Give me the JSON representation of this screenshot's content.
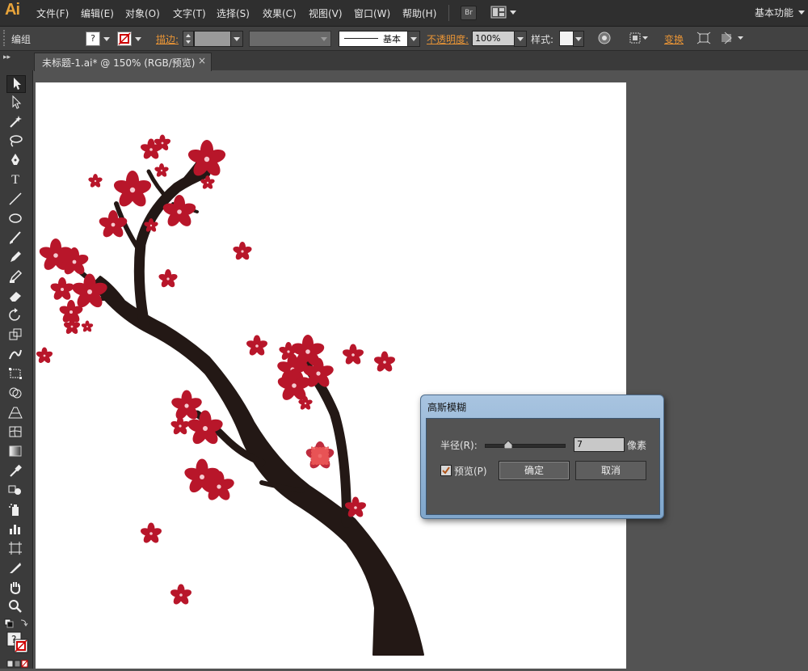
{
  "app": {
    "logo": "Ai"
  },
  "menu": {
    "items": [
      "文件(F)",
      "编辑(E)",
      "对象(O)",
      "文字(T)",
      "选择(S)",
      "效果(C)",
      "视图(V)",
      "窗口(W)",
      "帮助(H)"
    ],
    "bridge_label": "Br",
    "workspace": "基本功能"
  },
  "control": {
    "object_type": "编组",
    "fill_label": "?",
    "stroke_label": "描边:",
    "brush_label": "基本",
    "opacity_label": "不透明度:",
    "opacity_value": "100%",
    "style_label": "样式:",
    "transform_label": "变换"
  },
  "document": {
    "tab_title": "未标题-1.ai* @ 150% (RGB/预览)",
    "close_glyph": "×"
  },
  "dialog": {
    "title": "高斯模糊",
    "radius_label": "半径(R):",
    "radius_value": "7",
    "unit": "像素",
    "slider_level": 0.3,
    "preview_label": "预览(P)",
    "preview_checked": true,
    "ok_label": "确定",
    "cancel_label": "取消"
  },
  "colors": {
    "blossom": "#b8162a",
    "branch": "#231815",
    "accent": "#e89436",
    "selection": "#f05a5a"
  },
  "tools": [
    "selection-tool",
    "direct-selection-tool",
    "magic-wand-tool",
    "lasso-tool",
    "pen-tool",
    "type-tool",
    "line-tool",
    "ellipse-tool",
    "paintbrush-tool",
    "pencil-tool",
    "blob-brush-tool",
    "eraser-tool",
    "rotate-tool",
    "scale-tool",
    "warp-tool",
    "free-transform-tool",
    "shape-builder-tool",
    "perspective-grid-tool",
    "mesh-tool",
    "gradient-tool",
    "eyedropper-tool",
    "blend-tool",
    "symbol-sprayer-tool",
    "column-graph-tool",
    "artboard-tool",
    "slice-tool",
    "hand-tool",
    "zoom-tool"
  ]
}
